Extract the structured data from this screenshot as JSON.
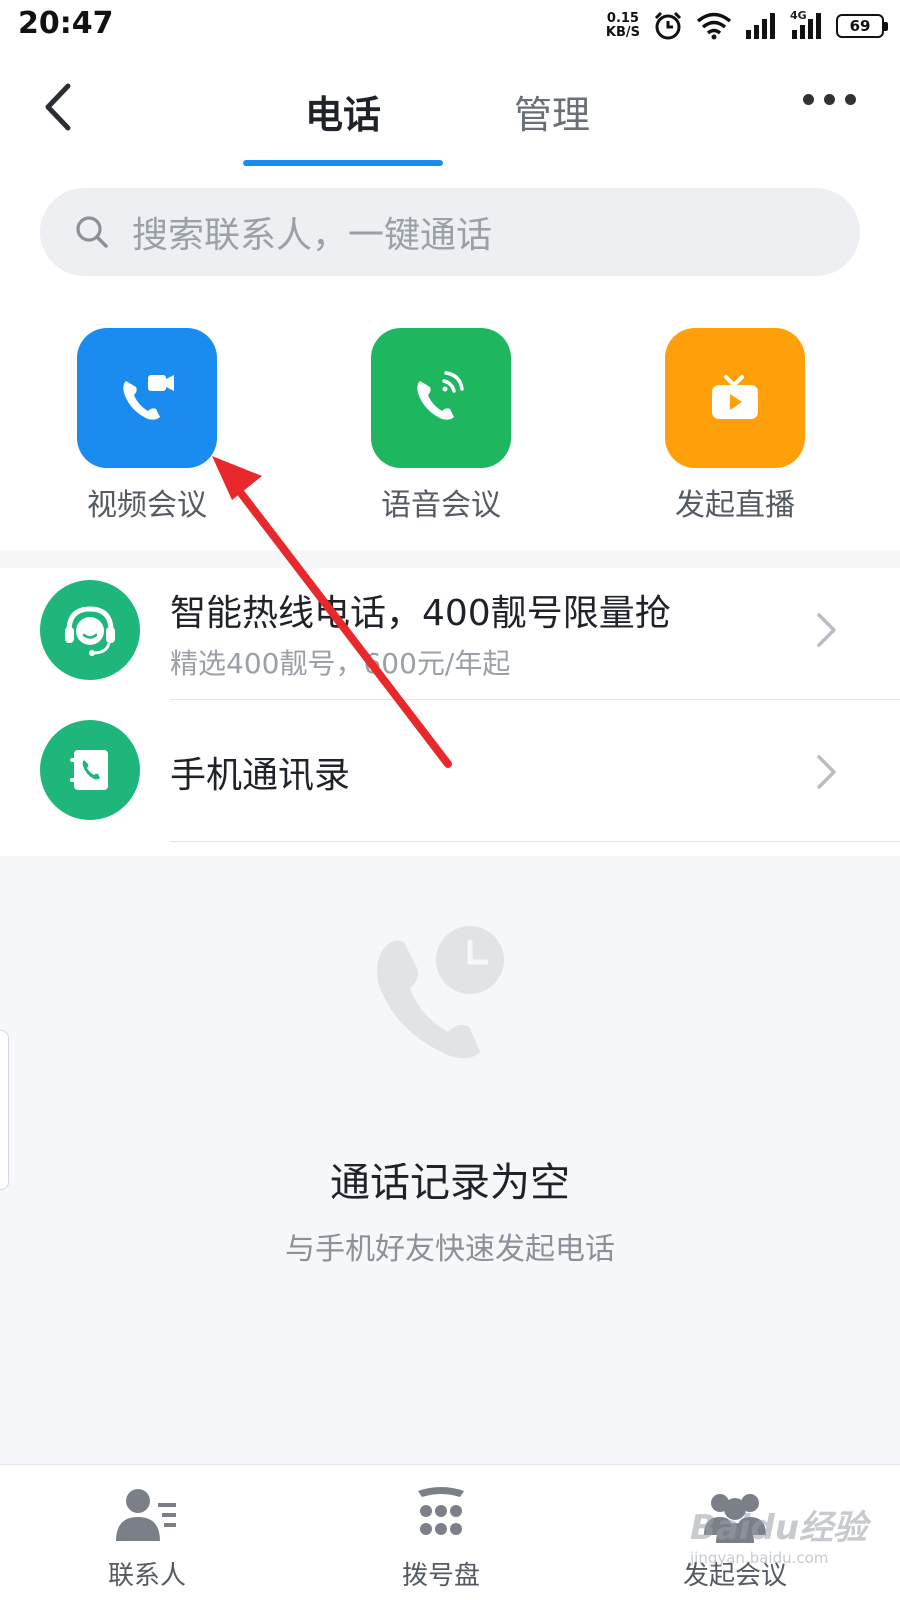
{
  "status_bar": {
    "time": "20:47",
    "net_speed_value": "0.15",
    "net_speed_unit": "KB/S",
    "network_type": "4G",
    "battery": "69"
  },
  "header": {
    "tabs": [
      {
        "label": "电话",
        "active": true
      },
      {
        "label": "管理",
        "active": false
      }
    ],
    "accent_color": "#1a8cf0"
  },
  "search": {
    "placeholder": "搜索联系人，一键通话"
  },
  "quick_actions": [
    {
      "label": "视频会议",
      "icon": "video-call-icon",
      "color": "#1a8cf0"
    },
    {
      "label": "语音会议",
      "icon": "voice-call-icon",
      "color": "#1fb660"
    },
    {
      "label": "发起直播",
      "icon": "live-tv-icon",
      "color": "#ffa00a"
    }
  ],
  "list": [
    {
      "title": "智能热线电话，400靓号限量抢",
      "subtitle": "精选400靓号，600元/年起",
      "icon": "customer-service-icon"
    },
    {
      "title": "手机通讯录",
      "icon": "phone-contacts-icon"
    }
  ],
  "empty_state": {
    "title": "通话记录为空",
    "subtitle": "与手机好友快速发起电话",
    "icon": "call-history-icon"
  },
  "bottom_nav": [
    {
      "label": "联系人",
      "icon": "contacts-icon"
    },
    {
      "label": "拨号盘",
      "icon": "dialpad-icon"
    },
    {
      "label": "发起会议",
      "icon": "meeting-icon"
    }
  ],
  "watermark": {
    "text": "Baidu经验",
    "url": "jingyan.baidu.com"
  }
}
